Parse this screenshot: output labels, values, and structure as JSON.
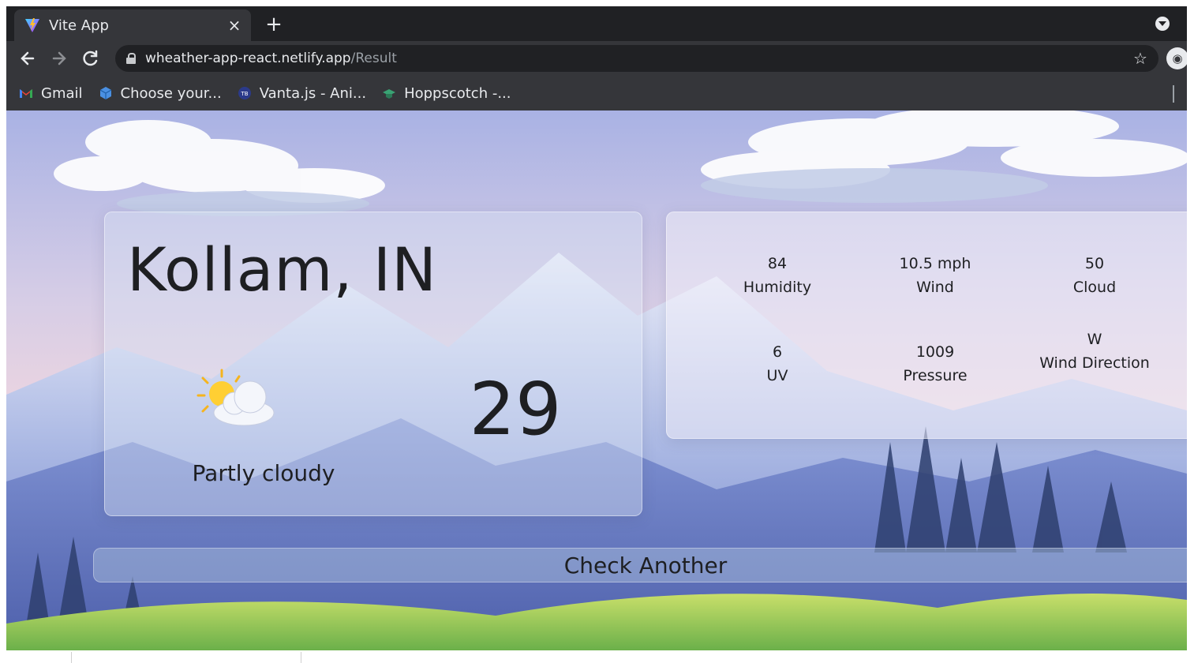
{
  "browser": {
    "tab_title": "Vite App",
    "tab_close": "×",
    "new_tab": "+",
    "url_host": "wheather-app-react.netlify.app",
    "url_path": "/Result",
    "bookmarks": [
      {
        "label": "Gmail",
        "icon": "gmail-icon"
      },
      {
        "label": "Choose your...",
        "icon": "cube-icon"
      },
      {
        "label": "Vanta.js - Ani...",
        "icon": "tb-icon"
      },
      {
        "label": "Hoppscotch -...",
        "icon": "hoppscotch-icon"
      }
    ],
    "colors": {
      "tabstrip": "#202124",
      "toolbar": "#35363a",
      "text": "#e8eaed"
    }
  },
  "weather": {
    "city": "Kollam, IN",
    "condition": "Partly cloudy",
    "condition_icon": "partly-cloudy-icon",
    "temperature": "29",
    "stats": [
      {
        "value": "84",
        "label": "Humidity"
      },
      {
        "value": "10.5 mph",
        "label": "Wind"
      },
      {
        "value": "50",
        "label": "Cloud"
      },
      {
        "value": "6",
        "label": "UV"
      },
      {
        "value": "1009",
        "label": "Pressure"
      },
      {
        "value": "W",
        "label": "Wind Direction"
      }
    ],
    "check_button": "Check Another"
  }
}
